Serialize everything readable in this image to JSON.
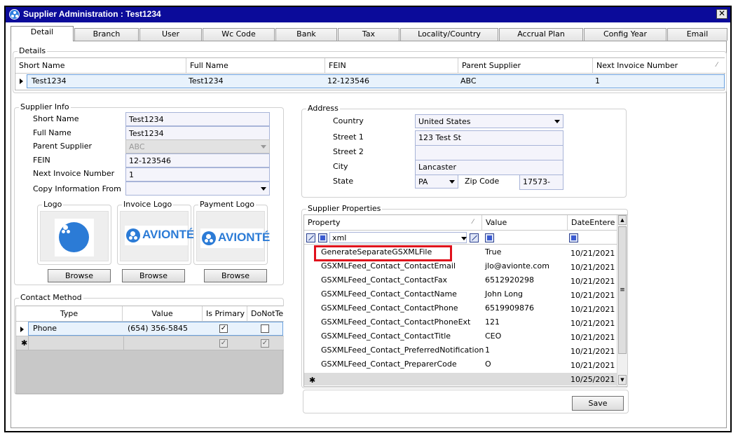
{
  "window": {
    "title": "Supplier Administration : Test1234",
    "close_label": "✕"
  },
  "tabs": [
    "Detail",
    "Branch",
    "User",
    "Wc Code",
    "Bank",
    "Tax",
    "Locality/Country",
    "Accrual Plan",
    "Config Year",
    "Email"
  ],
  "details": {
    "title": "Details",
    "columns": [
      "Short Name",
      "Full Name",
      "FEIN",
      "Parent Supplier",
      "Next Invoice Number"
    ],
    "row": [
      "Test1234",
      "Test1234",
      "12-123546",
      "ABC",
      "1"
    ]
  },
  "supplier_info": {
    "title": "Supplier Info",
    "fields": [
      {
        "label": "Short Name",
        "value": "Test1234"
      },
      {
        "label": "Full Name",
        "value": "Test1234"
      },
      {
        "label": "Parent Supplier",
        "value": "ABC"
      },
      {
        "label": "FEIN",
        "value": "12-123546"
      },
      {
        "label": "Next Invoice Number",
        "value": "1"
      },
      {
        "label": "Copy Information From",
        "value": ""
      }
    ]
  },
  "logos": {
    "logo_label": "Logo",
    "invoice_logo_label": "Invoice Logo",
    "payment_logo_label": "Payment Logo",
    "brand_text": "AVIONTÉ",
    "browse_label": "Browse"
  },
  "address": {
    "title": "Address",
    "country_label": "Country",
    "country_value": "United States",
    "street1_label": "Street 1",
    "street1_value": "123 Test St",
    "street2_label": "Street 2",
    "street2_value": "",
    "city_label": "City",
    "city_value": "Lancaster",
    "state_label": "State",
    "state_value": "PA",
    "zip_label": "Zip Code",
    "zip_value": "17573-"
  },
  "contact_method": {
    "title": "Contact Method",
    "columns": [
      "Type",
      "Value",
      "Is Primary",
      "DoNotTe"
    ],
    "rows": [
      {
        "type": "Phone",
        "value": "(654) 356-5845",
        "is_primary": true,
        "do_not": false
      }
    ]
  },
  "supplier_properties": {
    "title": "Supplier Properties",
    "columns": [
      "Property",
      "Value",
      "DateEntere"
    ],
    "filter_value": "xml",
    "rows": [
      {
        "property": "GenerateSeparateGSXMLFile",
        "value": "True",
        "date": "10/21/2021"
      },
      {
        "property": "GSXMLFeed_Contact_ContactEmail",
        "value": "jlo@avionte.com",
        "date": "10/21/2021"
      },
      {
        "property": "GSXMLFeed_Contact_ContactFax",
        "value": "6512920298",
        "date": "10/21/2021"
      },
      {
        "property": "GSXMLFeed_Contact_ContactName",
        "value": "John Long",
        "date": "10/21/2021"
      },
      {
        "property": "GSXMLFeed_Contact_ContactPhone",
        "value": "6519909876",
        "date": "10/21/2021"
      },
      {
        "property": "GSXMLFeed_Contact_ContactPhoneExt",
        "value": "121",
        "date": "10/21/2021"
      },
      {
        "property": "GSXMLFeed_Contact_ContactTitle",
        "value": "CEO",
        "date": "10/21/2021"
      },
      {
        "property": "GSXMLFeed_Contact_PreferredNotification",
        "value": "1",
        "date": "10/21/2021"
      },
      {
        "property": "GSXMLFeed_Contact_PreparerCode",
        "value": "O",
        "date": "10/21/2021"
      }
    ],
    "new_row_date": "10/25/2021",
    "highlight_color": "#e0101c"
  },
  "footer": {
    "save_label": "Save"
  },
  "glyphs": {
    "new_row": "✱",
    "check": "✓",
    "sort": "⁄",
    "up": "▲",
    "down": "▼",
    "grip": "≡"
  }
}
